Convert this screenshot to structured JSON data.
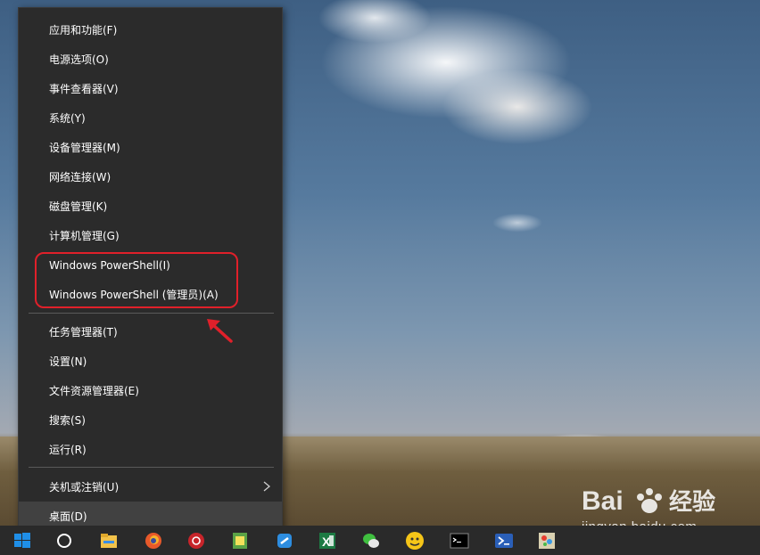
{
  "menu": {
    "items": [
      {
        "label": "应用和功能(F)"
      },
      {
        "label": "电源选项(O)"
      },
      {
        "label": "事件查看器(V)"
      },
      {
        "label": "系统(Y)"
      },
      {
        "label": "设备管理器(M)"
      },
      {
        "label": "网络连接(W)"
      },
      {
        "label": "磁盘管理(K)"
      },
      {
        "label": "计算机管理(G)"
      },
      {
        "label": "Windows PowerShell(I)"
      },
      {
        "label": "Windows PowerShell (管理员)(A)"
      },
      {
        "label": "任务管理器(T)"
      },
      {
        "label": "设置(N)"
      },
      {
        "label": "文件资源管理器(E)"
      },
      {
        "label": "搜索(S)"
      },
      {
        "label": "运行(R)"
      },
      {
        "label": "关机或注销(U)"
      },
      {
        "label": "桌面(D)"
      }
    ]
  },
  "annotation": {
    "color": "#e0202a"
  },
  "watermark": {
    "brand": "Bai 经验",
    "url": "jingyan.baidu.com"
  },
  "taskbar": {
    "icons": [
      "windows-start-icon",
      "cortana-icon",
      "file-explorer-icon",
      "firefox-icon",
      "netease-music-icon",
      "app-icon",
      "blue-app-icon",
      "excel-icon",
      "wechat-icon",
      "yellow-face-icon",
      "cmd-icon",
      "powershell-icon",
      "paint-app-icon"
    ]
  },
  "colors": {
    "menu_bg": "#2b2b2b",
    "menu_text": "#ffffff",
    "taskbar_bg": "#2a2a2a"
  }
}
